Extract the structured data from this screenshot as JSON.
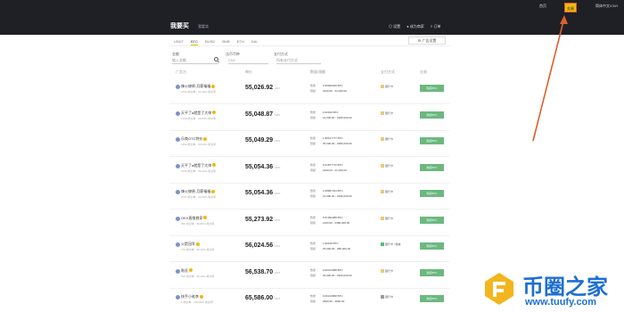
{
  "topnav": {
    "links": "首页",
    "trade": "交易",
    "lang": "简体中文/CNY"
  },
  "header": {
    "title": "我要买",
    "sub": "我要卖",
    "links": [
      "◎ 设置",
      "● 成为商家",
      "≡ 订单"
    ]
  },
  "tabs": {
    "items": [
      "USDT",
      "BTC",
      "BUSD",
      "BNB",
      "ETH",
      "DAI"
    ],
    "active": 1,
    "ad_settings": "⚙ 广告设置"
  },
  "filters": {
    "amount_label": "金额",
    "amount_placeholder": "输入金额",
    "currency_label": "法币币种",
    "currency_value": "CNY",
    "payment_label": "支付方式",
    "payment_value": "所有支付方式"
  },
  "columns": [
    "广告方",
    "单价",
    "数量/限额",
    "支付方式",
    "交易"
  ],
  "rows": [
    {
      "name": "烽火燎原-月薪福福",
      "stats": "2760 成交单 · 99.40% 成交率",
      "price": "55,026.92",
      "unit": "CNY",
      "qty": "0.99946429 BTC",
      "limit": "¥100.00 - ¥1,000.00",
      "pay": "银行卡",
      "pay_type": "card"
    },
    {
      "name": "天平了a就是了大帅",
      "stats": "1330 成交单 · 99.20% 成交率",
      "price": "55,048.87",
      "unit": "CNY",
      "qty": "0.02919 BTC",
      "limit": "¥1,000.00 - ¥380,000.00",
      "pay": "银行卡",
      "pay_type": "card"
    },
    {
      "name": "乐商OTC特价",
      "stats": "1260 成交单 · 99.60% 成交率",
      "price": "55,049.29",
      "unit": "CNY",
      "qty": "1.88127777 BTC",
      "limit": "¥5,000.00 - ¥380,000.00",
      "pay": "银行卡",
      "pay_type": "card"
    },
    {
      "name": "天平了a就是了大帅",
      "stats": "1330 成交单 · 99.20% 成交率",
      "price": "55,054.36",
      "unit": "CNY",
      "qty": "0.01877772 BTC",
      "limit": "¥100.00 - ¥1,000.00",
      "pay": "银行卡",
      "pay_type": "card"
    },
    {
      "name": "烽火燎原-月薪福福",
      "stats": "2760 成交单 · 99.40% 成交率",
      "price": "55,054.36",
      "unit": "CNY",
      "qty": "0.18987344 BTC",
      "limit": "¥1,000.00 - ¥290,000.00",
      "pay": "银行卡",
      "pay_type": "card"
    },
    {
      "name": "OKX直推商家",
      "stats": "980 成交单 · 98.80% 成交率",
      "price": "55,273.92",
      "unit": "CNY",
      "qty": "0.61992288 BTC",
      "limit": "¥100.00 - ¥380,000.00",
      "pay": "银行卡",
      "pay_type": "card"
    },
    {
      "name": "火箭冠军",
      "stats": "770 成交单 · 99.30% 成交率",
      "price": "56,024.56",
      "unit": "CNY",
      "qty": "1.99108 BTC",
      "limit": "¥5,000.00 - ¥80,000.00",
      "pay": "银行卡 / 微信",
      "pay_type": "wx"
    },
    {
      "name": "陈氏",
      "stats": "600 成交单 · 99.00% 成交率",
      "price": "56,538.70",
      "unit": "CNY",
      "qty": "0.06413388 BTC",
      "limit": "¥5,000.00 - ¥200,000.00",
      "pay": "银行卡",
      "pay_type": "card"
    },
    {
      "name": "快手小老李",
      "stats": "1 成交单 · 100.00% 成交率",
      "price": "65,586.00",
      "unit": "CNY",
      "qty": "0.00213808 BTC",
      "limit": "¥500.00 - ¥800.00",
      "pay": "银行卡",
      "pay_type": "bank"
    }
  ],
  "buy_label": "购买BTC",
  "qty_label": "数量",
  "limit_label": "限额",
  "watermark": {
    "text": "币圈之家",
    "url": "www.tuufy.com"
  },
  "colors": {
    "dark": "#1e2026",
    "accent": "#f0b90b",
    "buy": "#6cb87f",
    "arrow": "#d9602f",
    "watermark": "#1d6fd1"
  }
}
